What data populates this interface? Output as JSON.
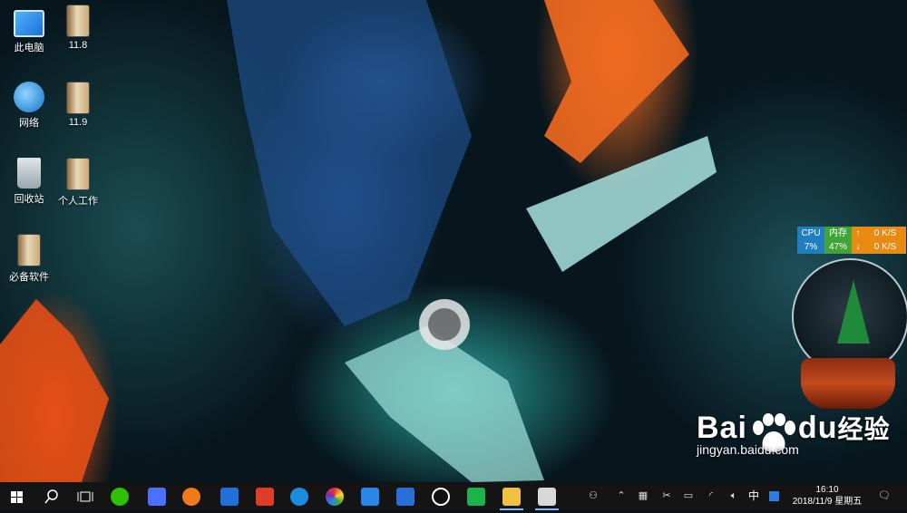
{
  "desktop": {
    "icons": [
      {
        "label": "此电脑"
      },
      {
        "label": "11.8"
      },
      {
        "label": "网络"
      },
      {
        "label": "11.9"
      },
      {
        "label": "回收站"
      },
      {
        "label": "个人工作"
      },
      {
        "label": "必备软件"
      }
    ]
  },
  "net_widget": {
    "cpu_label": "CPU",
    "cpu_value": "7%",
    "mem_label": "内存",
    "mem_value": "47%",
    "up_arrow": "↑",
    "down_arrow": "↓",
    "up_speed": "0 K/S",
    "down_speed": "0 K/S",
    "colors": {
      "cpu": "#1e7fc0",
      "mem": "#3fa336",
      "speed": "#e98a13"
    }
  },
  "watermark": {
    "brand": "Bai",
    "brand_du": "du",
    "brand_cn": "经验",
    "url": "jingyan.baidu.com"
  },
  "taskbar": {
    "apps": [
      {
        "icon": "wechat-icon",
        "color": "#2dc100"
      },
      {
        "icon": "feishu-icon",
        "color": "#4c6fff"
      },
      {
        "icon": "music-headphone-icon",
        "color": "#f07a1a"
      },
      {
        "icon": "office-icon",
        "color": "#2170d8"
      },
      {
        "icon": "it-app-icon",
        "color": "#e03c2c"
      },
      {
        "icon": "ie-browser-icon",
        "color": "#1a8de0"
      },
      {
        "icon": "color-wheel-icon",
        "color": "#d9a020"
      },
      {
        "icon": "support-headset-icon",
        "color": "#2a86e8"
      },
      {
        "icon": "calendar-app-icon",
        "color": "#2a6ed8"
      },
      {
        "icon": "qq-icon",
        "color": "#ffffff"
      },
      {
        "icon": "wps-spreadsheet-icon",
        "color": "#1cb34a"
      },
      {
        "icon": "file-explorer-icon",
        "color": "#f0c040"
      },
      {
        "icon": "photos-icon",
        "color": "#d8d8d8"
      }
    ],
    "tray": {
      "ime_mode": "中",
      "time": "16:10",
      "date": "2018/11/9 星期五"
    }
  }
}
